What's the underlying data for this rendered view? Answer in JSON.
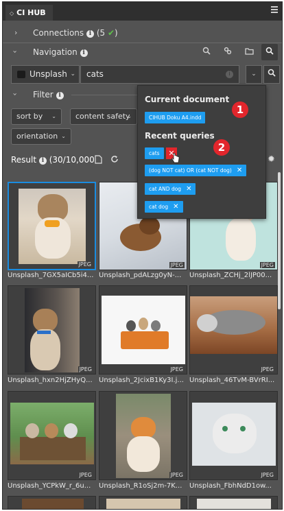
{
  "panel": {
    "title": "CI HUB",
    "menu_icon": "hamburger-icon"
  },
  "sections": {
    "connections_label": "Connections",
    "connections_count": "(5",
    "navigation_label": "Navigation",
    "filter_label": "Filter"
  },
  "search": {
    "source": "Unsplash",
    "query": "cats"
  },
  "filters": {
    "sort_by": "sort by",
    "content_safety": "content safety",
    "orientation": "orientation"
  },
  "result": {
    "label": "Result",
    "count": "(30/10,000"
  },
  "popover": {
    "current_document_heading": "Current document",
    "document_chip": "CIHUB Doku A4.indd",
    "recent_heading": "Recent queries",
    "queries": [
      "cats",
      "(dog NOT cat) OR (cat NOT dog)",
      "cat AND dog",
      "cat dog"
    ],
    "badge_1": "1",
    "badge_2": "2"
  },
  "tiles": [
    {
      "caption": "Unsplash_7GX5aICb5i4...",
      "format": "JPEG"
    },
    {
      "caption": "Unsplash_pdALzg0yN-...",
      "format": "JPEG"
    },
    {
      "caption": "Unsplash_ZCHj_2lJP00...",
      "format": "JPEG"
    },
    {
      "caption": "Unsplash_hxn2HjZHyQ...",
      "format": "JPEG"
    },
    {
      "caption": "Unsplash_2JcixB1Ky3I.j...",
      "format": "JPEG"
    },
    {
      "caption": "Unsplash_46TvM-BVrRI...",
      "format": "JPEG"
    },
    {
      "caption": "Unsplash_YCPkW_r_6u...",
      "format": "JPEG"
    },
    {
      "caption": "Unsplash_R1oSj2m-7K...",
      "format": "JPEG"
    },
    {
      "caption": "Unsplash_FbhNdD1ow...",
      "format": "JPEG"
    }
  ],
  "colors": {
    "accent_blue": "#1e9df0",
    "badge_red": "#e2262c",
    "check_green": "#5fc24a"
  }
}
